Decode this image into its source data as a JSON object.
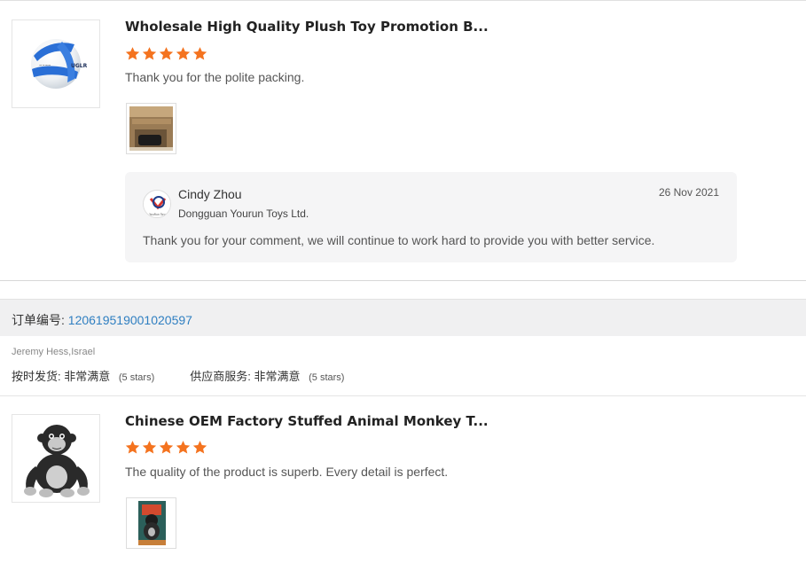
{
  "reviews": [
    {
      "title": "Wholesale High Quality Plush Toy Promotion B...",
      "rating": 5,
      "comment": "Thank you for the polite packing.",
      "reply": {
        "name": "Cindy Zhou",
        "company": "Dongguan Yourun Toys Ltd.",
        "date": "26 Nov 2021",
        "text": "Thank you for your comment, we will continue to work hard to provide you with better service.",
        "logo_text": "YouRun Toys"
      }
    },
    {
      "title": "Chinese OEM Factory Stuffed Animal Monkey T...",
      "rating": 5,
      "comment": "The quality of the product is superb. Every detail is perfect."
    }
  ],
  "order": {
    "label": "订单编号:",
    "number": "120619519001020597"
  },
  "buyer": "Jeremy Hess,Israel",
  "ratings": [
    {
      "label": "按时发货:",
      "value": "非常满意",
      "stars": "(5 stars)"
    },
    {
      "label": "供应商服务:",
      "value": "非常满意",
      "stars": "(5 stars)"
    }
  ],
  "colors": {
    "star": "#f4731f",
    "link": "#2f7fc1",
    "reply_bg": "#f5f5f6",
    "order_bar_bg": "#f0f0f1"
  }
}
